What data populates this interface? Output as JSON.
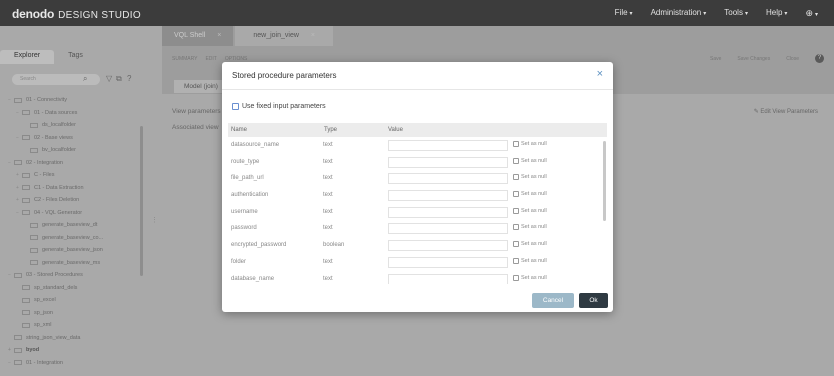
{
  "app": {
    "logo": "denodo",
    "logo_sub": "DESIGN STUDIO",
    "menu": [
      "File",
      "Administration",
      "Tools",
      "Help"
    ]
  },
  "left_panel": {
    "tabs": [
      "Explorer",
      "Tags"
    ],
    "search_placeholder": "Search",
    "tree": [
      {
        "label": "01 - Connectivity",
        "indent": 0,
        "toggle": "−"
      },
      {
        "label": "01 - Data sources",
        "indent": 1,
        "toggle": "−"
      },
      {
        "label": "ds_localfolder",
        "indent": 2,
        "toggle": ""
      },
      {
        "label": "02 - Base views",
        "indent": 1,
        "toggle": "−"
      },
      {
        "label": "bv_localfolder",
        "indent": 2,
        "toggle": ""
      },
      {
        "label": "02 - Integration",
        "indent": 0,
        "toggle": "−"
      },
      {
        "label": "C - Files",
        "indent": 1,
        "toggle": "+"
      },
      {
        "label": "C1 - Data Extraction",
        "indent": 1,
        "toggle": "+"
      },
      {
        "label": "C2 - Files Deletion",
        "indent": 1,
        "toggle": "+"
      },
      {
        "label": "04 - VQL Generator",
        "indent": 1,
        "toggle": "−"
      },
      {
        "label": "generate_baseview_dt",
        "indent": 2,
        "toggle": ""
      },
      {
        "label": "generate_baseview_co...",
        "indent": 2,
        "toggle": ""
      },
      {
        "label": "generate_baseview_json",
        "indent": 2,
        "toggle": ""
      },
      {
        "label": "generate_baseview_ms",
        "indent": 2,
        "toggle": ""
      },
      {
        "label": "03 - Stored Procedures",
        "indent": 0,
        "toggle": "−"
      },
      {
        "label": "sp_standard_dels",
        "indent": 1,
        "toggle": ""
      },
      {
        "label": "sp_excel",
        "indent": 1,
        "toggle": ""
      },
      {
        "label": "sp_json",
        "indent": 1,
        "toggle": ""
      },
      {
        "label": "sp_xml",
        "indent": 1,
        "toggle": ""
      },
      {
        "label": "string_json_view_data",
        "indent": 0,
        "toggle": ""
      },
      {
        "label": "byod",
        "indent": 0,
        "toggle": "+",
        "bold": true
      },
      {
        "label": "01 - Integration",
        "indent": 0,
        "toggle": "−"
      }
    ]
  },
  "main": {
    "tabs": [
      {
        "label": "VQL Shell",
        "active": false
      },
      {
        "label": "new_join_view",
        "active": true
      }
    ],
    "subbar_left": [
      "SUMMARY",
      "EDIT",
      "OPTIONS"
    ],
    "subbar_right": [
      "Save",
      "Save Changes",
      "Close"
    ],
    "model_tab": "Model (join)",
    "view_parameters": "View parameters",
    "associated_view": "Associated view",
    "edit_view_parameters": "Edit View Parameters"
  },
  "modal": {
    "title": "Stored procedure parameters",
    "fixed_input_label": "Use fixed input parameters",
    "columns": [
      "Name",
      "Type",
      "Value"
    ],
    "set_null_label": "Set as null",
    "rows": [
      {
        "name": "datasource_name",
        "type": "text"
      },
      {
        "name": "route_type",
        "type": "text"
      },
      {
        "name": "file_path_url",
        "type": "text"
      },
      {
        "name": "authentication",
        "type": "text"
      },
      {
        "name": "username",
        "type": "text"
      },
      {
        "name": "password",
        "type": "text"
      },
      {
        "name": "encrypted_password",
        "type": "boolean"
      },
      {
        "name": "folder",
        "type": "text"
      },
      {
        "name": "database_name",
        "type": "text"
      }
    ],
    "cancel_label": "Cancel",
    "ok_label": "Ok"
  }
}
